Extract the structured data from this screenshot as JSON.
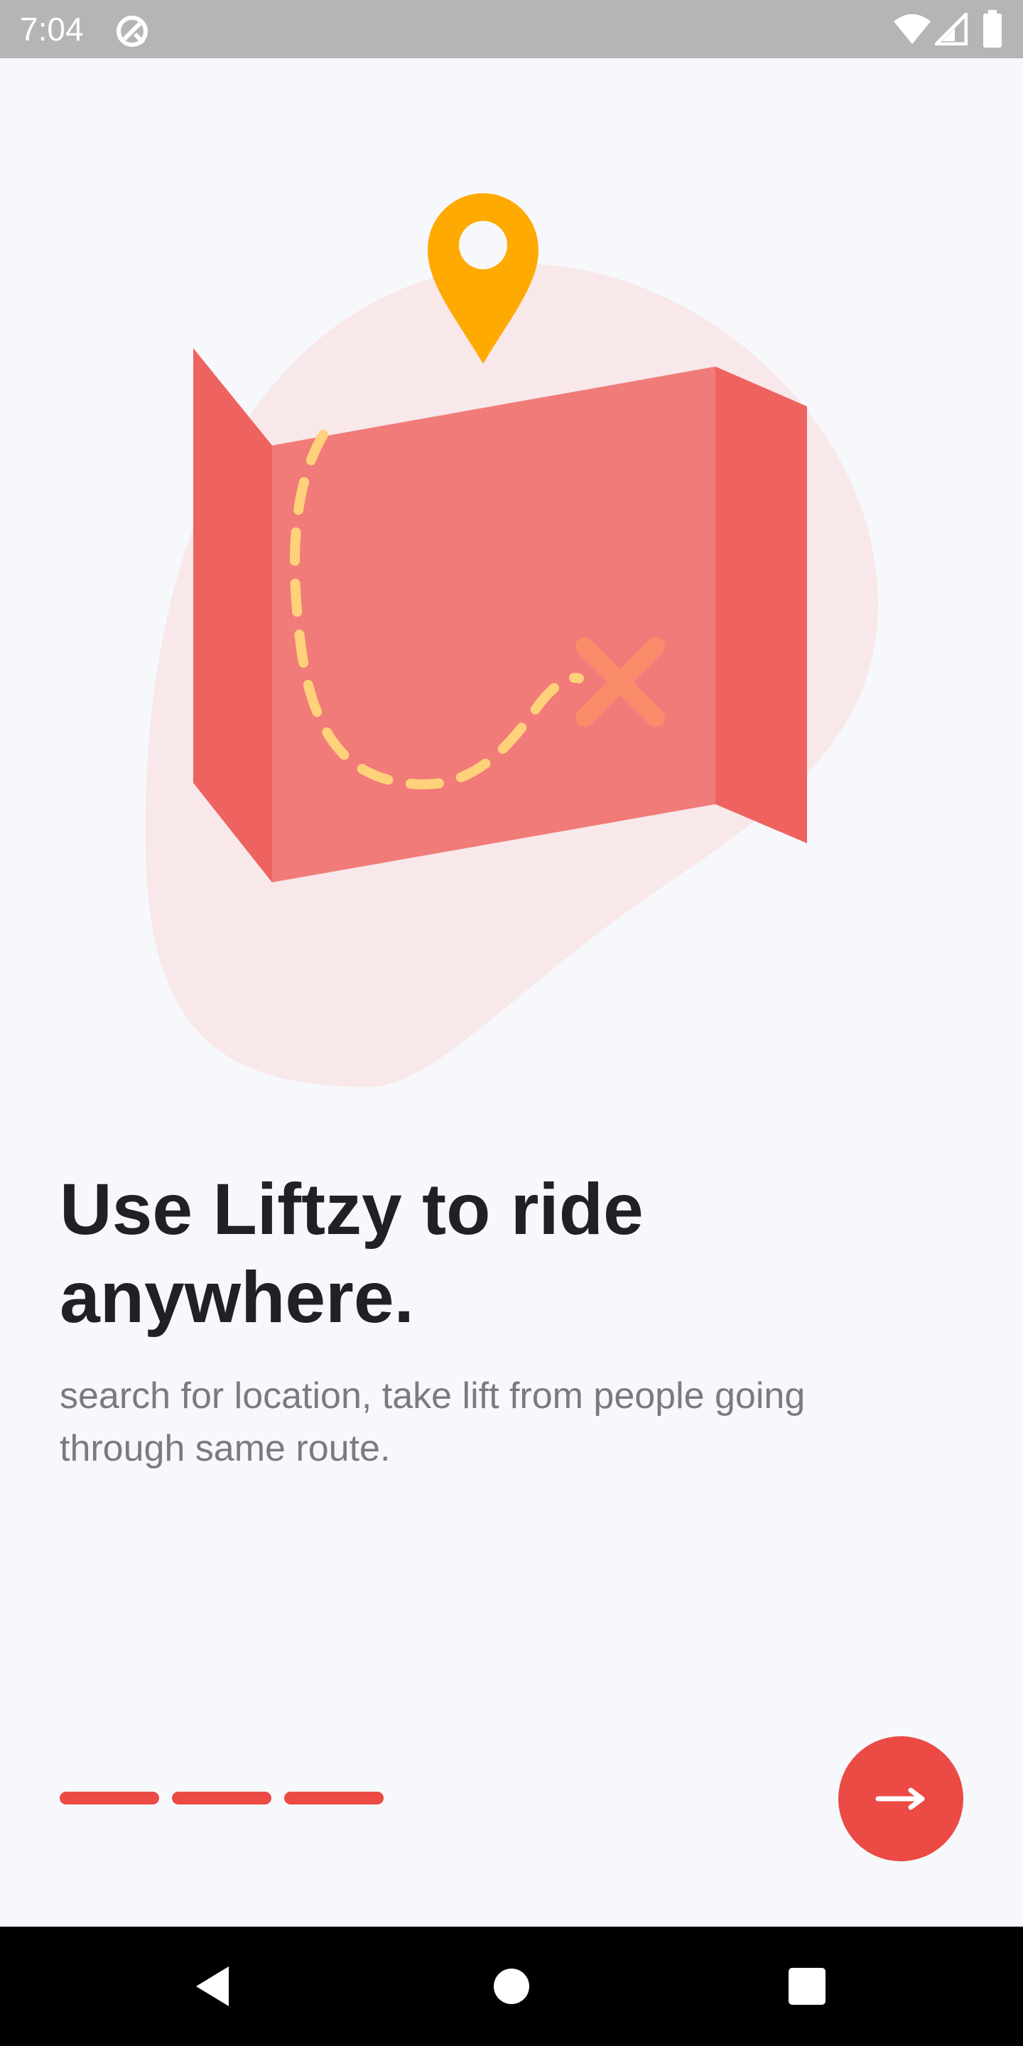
{
  "status_bar": {
    "time": "7:04",
    "icons": [
      "do-not-disturb-icon",
      "wifi-icon",
      "signal-icon",
      "battery-icon"
    ]
  },
  "onboarding": {
    "illustration": [
      "map-icon",
      "location-pin-icon",
      "destination-x-icon"
    ],
    "headline": "Use Liftzy to ride anywhere.",
    "subtext": "search for location, take lift from people going through same route.",
    "page_count": 3,
    "next_icon": "arrow-right-icon"
  },
  "nav_bar": {
    "buttons": [
      "back-icon",
      "home-icon",
      "recents-icon"
    ]
  },
  "colors": {
    "accent": "#ec4a45",
    "map": "#f07b78",
    "map_side": "#ee6360",
    "pin": "#ffaa00",
    "route": "#ffd17a",
    "blob": "#f8e8ea",
    "headline": "#202124",
    "subtext": "#7a7a7f",
    "status_bar": "#b5b5b5",
    "nav_bar": "#000000"
  }
}
